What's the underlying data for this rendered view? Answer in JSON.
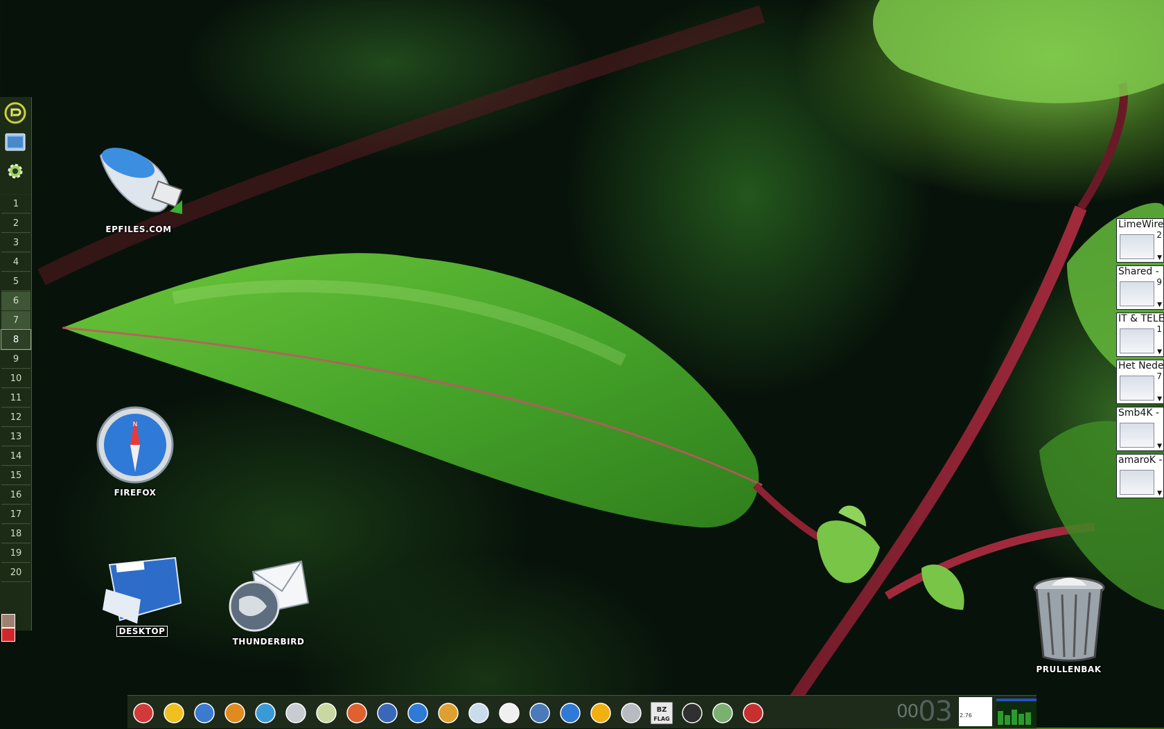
{
  "pager": {
    "desktops": [
      "1",
      "2",
      "3",
      "4",
      "5",
      "6",
      "7",
      "8",
      "9",
      "10",
      "11",
      "12",
      "13",
      "14",
      "15",
      "16",
      "17",
      "18",
      "19",
      "20"
    ],
    "active_desktop": "8",
    "launcher_icons": [
      "kmenu-icon",
      "file-manager-icon",
      "settings-icon"
    ]
  },
  "desktop_icons": {
    "usb": {
      "label": "EPFILES.COM"
    },
    "firefox": {
      "label": "FIREFOX"
    },
    "desktop": {
      "label": "DESKTOP"
    },
    "thunderbird": {
      "label": "THUNDERBIRD"
    },
    "trash": {
      "label": "PRULLENBAK"
    }
  },
  "taskbar": [
    {
      "title": "LimeWire",
      "count": "2"
    },
    {
      "title": "Shared -",
      "count": "9"
    },
    {
      "title": "IT & TELE",
      "count": "1"
    },
    {
      "title": "Het Nede",
      "count": "7"
    },
    {
      "title": "Smb4K -",
      "count": ""
    },
    {
      "title": "amaroK -",
      "count": ""
    }
  ],
  "dock_icons": [
    "mail-app-icon",
    "favorites-star-icon",
    "network-globe-icon",
    "media-sphere-icon",
    "network-computer-icon",
    "printer-icon",
    "search-tools-icon",
    "home-folder-icon",
    "thunderbird-icon",
    "safari-compass-icon",
    "orb-icon",
    "itunes-icon",
    "tux-icon",
    "preview-icon",
    "accessibility-icon",
    "aim-icon",
    "camera-icon",
    "bzflag-icon",
    "terminal-icon",
    "calculator-icon",
    "shield-icon"
  ],
  "dock_labels": {
    "bzflag": "BZ FLAG"
  },
  "clock": {
    "hours": "00",
    "minutes": "03"
  },
  "mini_monitor": {
    "line1": "2.76"
  },
  "colors": {
    "panel": "#1e2a1a",
    "accent": "#7fc84a"
  }
}
